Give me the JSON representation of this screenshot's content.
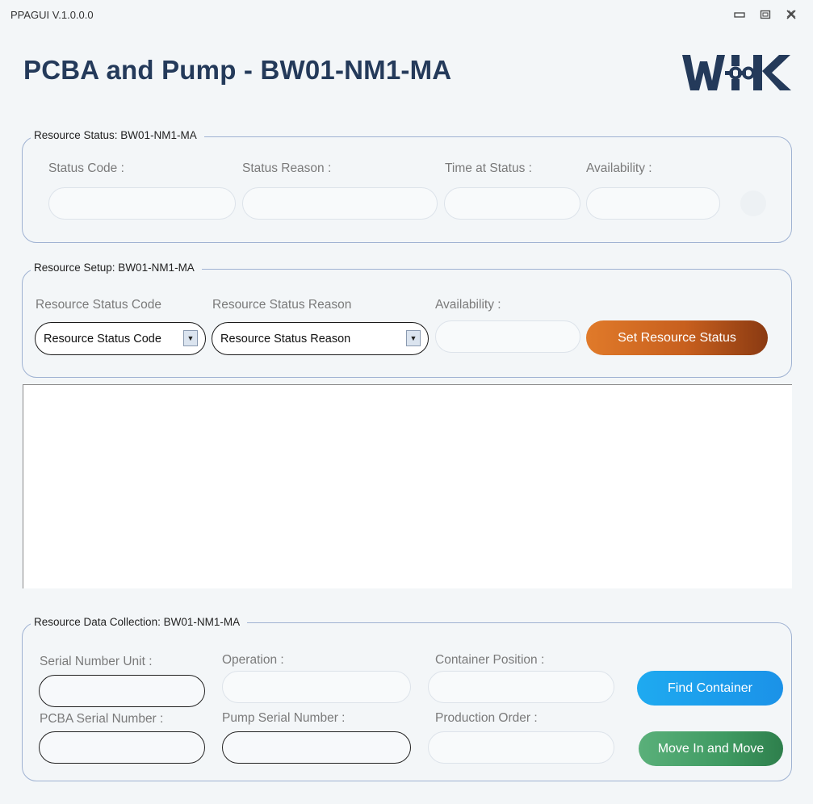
{
  "window": {
    "title": "PPAGUI V.1.0.0.0",
    "minimize_icon": "minimize-icon",
    "maximize_icon": "maximize-icon",
    "close_icon": "close-icon"
  },
  "header": {
    "title": "PCBA and Pump - BW01-NM1-MA",
    "logo_text": "WIK",
    "logo_color": "#243a5a"
  },
  "resource_status": {
    "legend": "Resource Status: BW01-NM1-MA",
    "status_code_label": "Status Code :",
    "status_code_value": "",
    "status_reason_label": "Status Reason :",
    "status_reason_value": "",
    "time_at_status_label": "Time at Status :",
    "time_at_status_value": "",
    "availability_label": "Availability :",
    "availability_value": ""
  },
  "resource_setup": {
    "legend": "Resource Setup: BW01-NM1-MA",
    "status_code_label": "Resource Status Code",
    "status_code_selected": "Resource Status Code",
    "status_reason_label": "Resource Status Reason",
    "status_reason_selected": "Resource Status Reason",
    "availability_label": "Availability :",
    "availability_value": "",
    "set_button": "Set Resource Status",
    "set_button_color": "#c75f1e"
  },
  "log": {
    "text": ""
  },
  "data_collection": {
    "legend": "Resource Data Collection: BW01-NM1-MA",
    "serial_number_unit_label": "Serial Number Unit :",
    "serial_number_unit_value": "",
    "operation_label": "Operation :",
    "operation_value": "",
    "container_position_label": "Container Position :",
    "container_position_value": "",
    "pcba_serial_label": "PCBA Serial Number :",
    "pcba_serial_value": "",
    "pump_serial_label": "Pump Serial Number :",
    "pump_serial_value": "",
    "production_order_label": "Production Order :",
    "production_order_value": "",
    "find_button": "Find Container",
    "find_button_color": "#1b92e8",
    "move_button": "Move In and Move",
    "move_button_color": "#3f9a62"
  }
}
